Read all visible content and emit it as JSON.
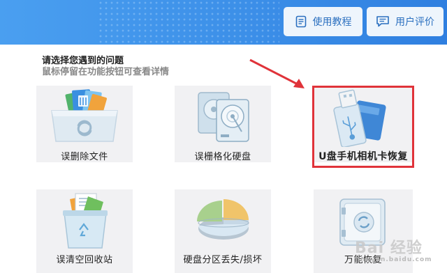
{
  "header": {
    "guide_label": "使用教程",
    "review_label": "用户评价"
  },
  "intro": {
    "title": "请选择您遇到的问题",
    "subtitle": "鼠标停留在功能按钮可查看详情"
  },
  "tiles": [
    {
      "label": "误删除文件",
      "icon": "deleted-files-icon"
    },
    {
      "label": "误栅格化硬盘",
      "icon": "formatted-disk-icon"
    },
    {
      "label": "U盘手机相机卡恢复",
      "icon": "usb-sdcard-icon"
    },
    {
      "label": "误清空回收站",
      "icon": "recycle-bin-icon"
    },
    {
      "label": "硬盘分区丢失/损坏",
      "icon": "partition-pie-icon"
    },
    {
      "label": "万能恢复",
      "icon": "universal-recovery-icon"
    }
  ],
  "watermark": {
    "text": "Bai 经验",
    "sub": "jingyan.baidu.com"
  },
  "colors": {
    "banner": "#3c8fe8",
    "highlight": "#e0333a",
    "arrow": "#e0333a"
  }
}
